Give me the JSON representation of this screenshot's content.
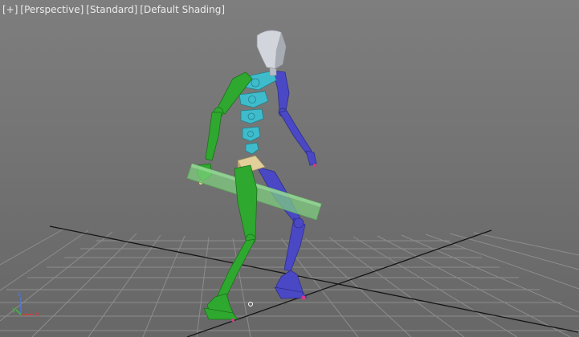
{
  "viewport": {
    "labels": {
      "plus": "[+]",
      "view": "[Perspective]",
      "stat": "[Standard]",
      "shading": "[Default Shading]"
    },
    "axis_tripod": {
      "x": "x",
      "y": "y",
      "z": "z",
      "x_color": "#d43c3c",
      "y_color": "#3cc43c",
      "z_color": "#4a78e0"
    }
  },
  "scene_objects": [
    "biped-head",
    "biped-spine",
    "biped-pelvis",
    "biped-left-arm",
    "biped-right-arm",
    "biped-left-leg",
    "biped-right-leg",
    "staff-prop"
  ],
  "colors": {
    "background_top": "#7e7e7e",
    "background_bottom": "#676767",
    "grid_line": "#8c8c8c",
    "grid_axis": "#111111",
    "left_limb": "#2ea82e",
    "right_limb": "#4a48c4",
    "spine": "#3fbccc",
    "head": "#d2d6dc",
    "pelvis": "#e2cf9a",
    "staff": "#7fd07f"
  }
}
